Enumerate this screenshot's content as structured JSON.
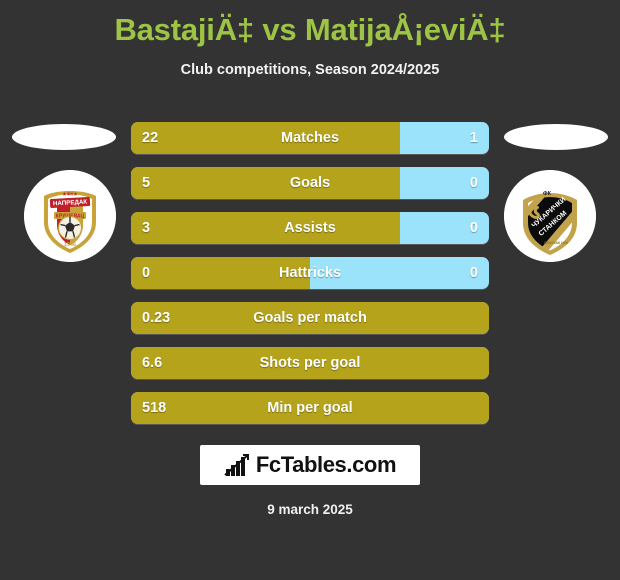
{
  "header": {
    "title": "BastajiÄ‡ vs MatijaÅ¡eviÄ‡",
    "subtitle": "Club competitions, Season 2024/2025"
  },
  "teams": {
    "home": {
      "badge_name": "fk-napredak-krusevac-badge",
      "badge_text_top": "ФК",
      "badge_text_main": "НАПРЕДАК",
      "badge_text_sub": "КРУШЕВАЦ",
      "badge_year": "1946"
    },
    "away": {
      "badge_name": "fk-cukaricki-stankom-badge",
      "badge_text_top": "ФК",
      "badge_text_main": "ЧУКАРИЧКИ",
      "badge_text_sub": "СТАНКОМ"
    }
  },
  "colors": {
    "background": "#333333",
    "title": "#9dc444",
    "home_bar": "#b5a41b",
    "away_bar": "#9ae3fa",
    "text": "#ffffff"
  },
  "chart_data": {
    "type": "bar",
    "title": "BastajiÄ‡ vs MatijaÅ¡eviÄ‡",
    "subtitle": "Club competitions, Season 2024/2025",
    "orientation": "horizontal-opposed",
    "series": [
      {
        "name": "home",
        "color": "#b5a41b"
      },
      {
        "name": "away",
        "color": "#9ae3fa"
      }
    ],
    "categories": [
      "Matches",
      "Goals",
      "Assists",
      "Hattricks",
      "Goals per match",
      "Shots per goal",
      "Min per goal"
    ],
    "rows": [
      {
        "label": "Matches",
        "home": "22",
        "away": "1",
        "home_pct": 75,
        "has_away": true
      },
      {
        "label": "Goals",
        "home": "5",
        "away": "0",
        "home_pct": 75,
        "has_away": true
      },
      {
        "label": "Assists",
        "home": "3",
        "away": "0",
        "home_pct": 75,
        "has_away": true
      },
      {
        "label": "Hattricks",
        "home": "0",
        "away": "0",
        "home_pct": 50,
        "has_away": true
      },
      {
        "label": "Goals per match",
        "home": "0.23",
        "away": "",
        "home_pct": 100,
        "has_away": false
      },
      {
        "label": "Shots per goal",
        "home": "6.6",
        "away": "",
        "home_pct": 100,
        "has_away": false
      },
      {
        "label": "Min per goal",
        "home": "518",
        "away": "",
        "home_pct": 100,
        "has_away": false
      }
    ]
  },
  "footer": {
    "brand": "FcTables.com",
    "brand_icon": "bar-chart-icon",
    "date": "9 march 2025"
  }
}
